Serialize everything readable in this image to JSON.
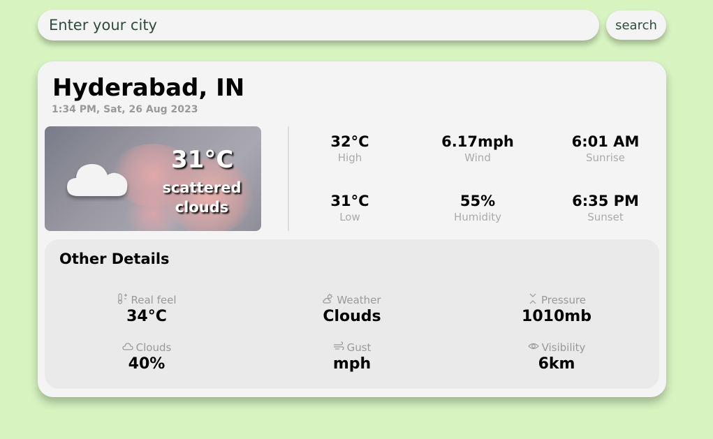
{
  "search": {
    "placeholder": "Enter your city",
    "button_label": "search"
  },
  "location": {
    "city": "Hyderabad, IN",
    "datetime": "1:34 PM, Sat, 26 Aug 2023"
  },
  "current": {
    "temp": "31°C",
    "description_line1": "scattered",
    "description_line2": "clouds",
    "icon": "cloud-icon"
  },
  "stats": [
    {
      "value": "32°C",
      "label": "High"
    },
    {
      "value": "6.17mph",
      "label": "Wind"
    },
    {
      "value": "6:01 AM",
      "label": "Sunrise"
    },
    {
      "value": "31°C",
      "label": "Low"
    },
    {
      "value": "55%",
      "label": "Humidity"
    },
    {
      "value": "6:35 PM",
      "label": "Sunset"
    }
  ],
  "details": {
    "title": "Other Details",
    "items": [
      {
        "label": "Real feel",
        "value": "34°C",
        "icon": "thermometer-icon"
      },
      {
        "label": "Weather",
        "value": "Clouds",
        "icon": "sun-cloud-icon"
      },
      {
        "label": "Pressure",
        "value": "1010mb",
        "icon": "pressure-icon"
      },
      {
        "label": "Clouds",
        "value": "40%",
        "icon": "cloud-outline-icon"
      },
      {
        "label": "Gust",
        "value": "mph",
        "icon": "wind-icon"
      },
      {
        "label": "Visibility",
        "value": "6km",
        "icon": "eye-icon"
      }
    ]
  },
  "colors": {
    "background": "#d6f3c0",
    "card": "#f4f4f4",
    "details_panel": "#eaeaea",
    "muted_text": "#999999"
  }
}
